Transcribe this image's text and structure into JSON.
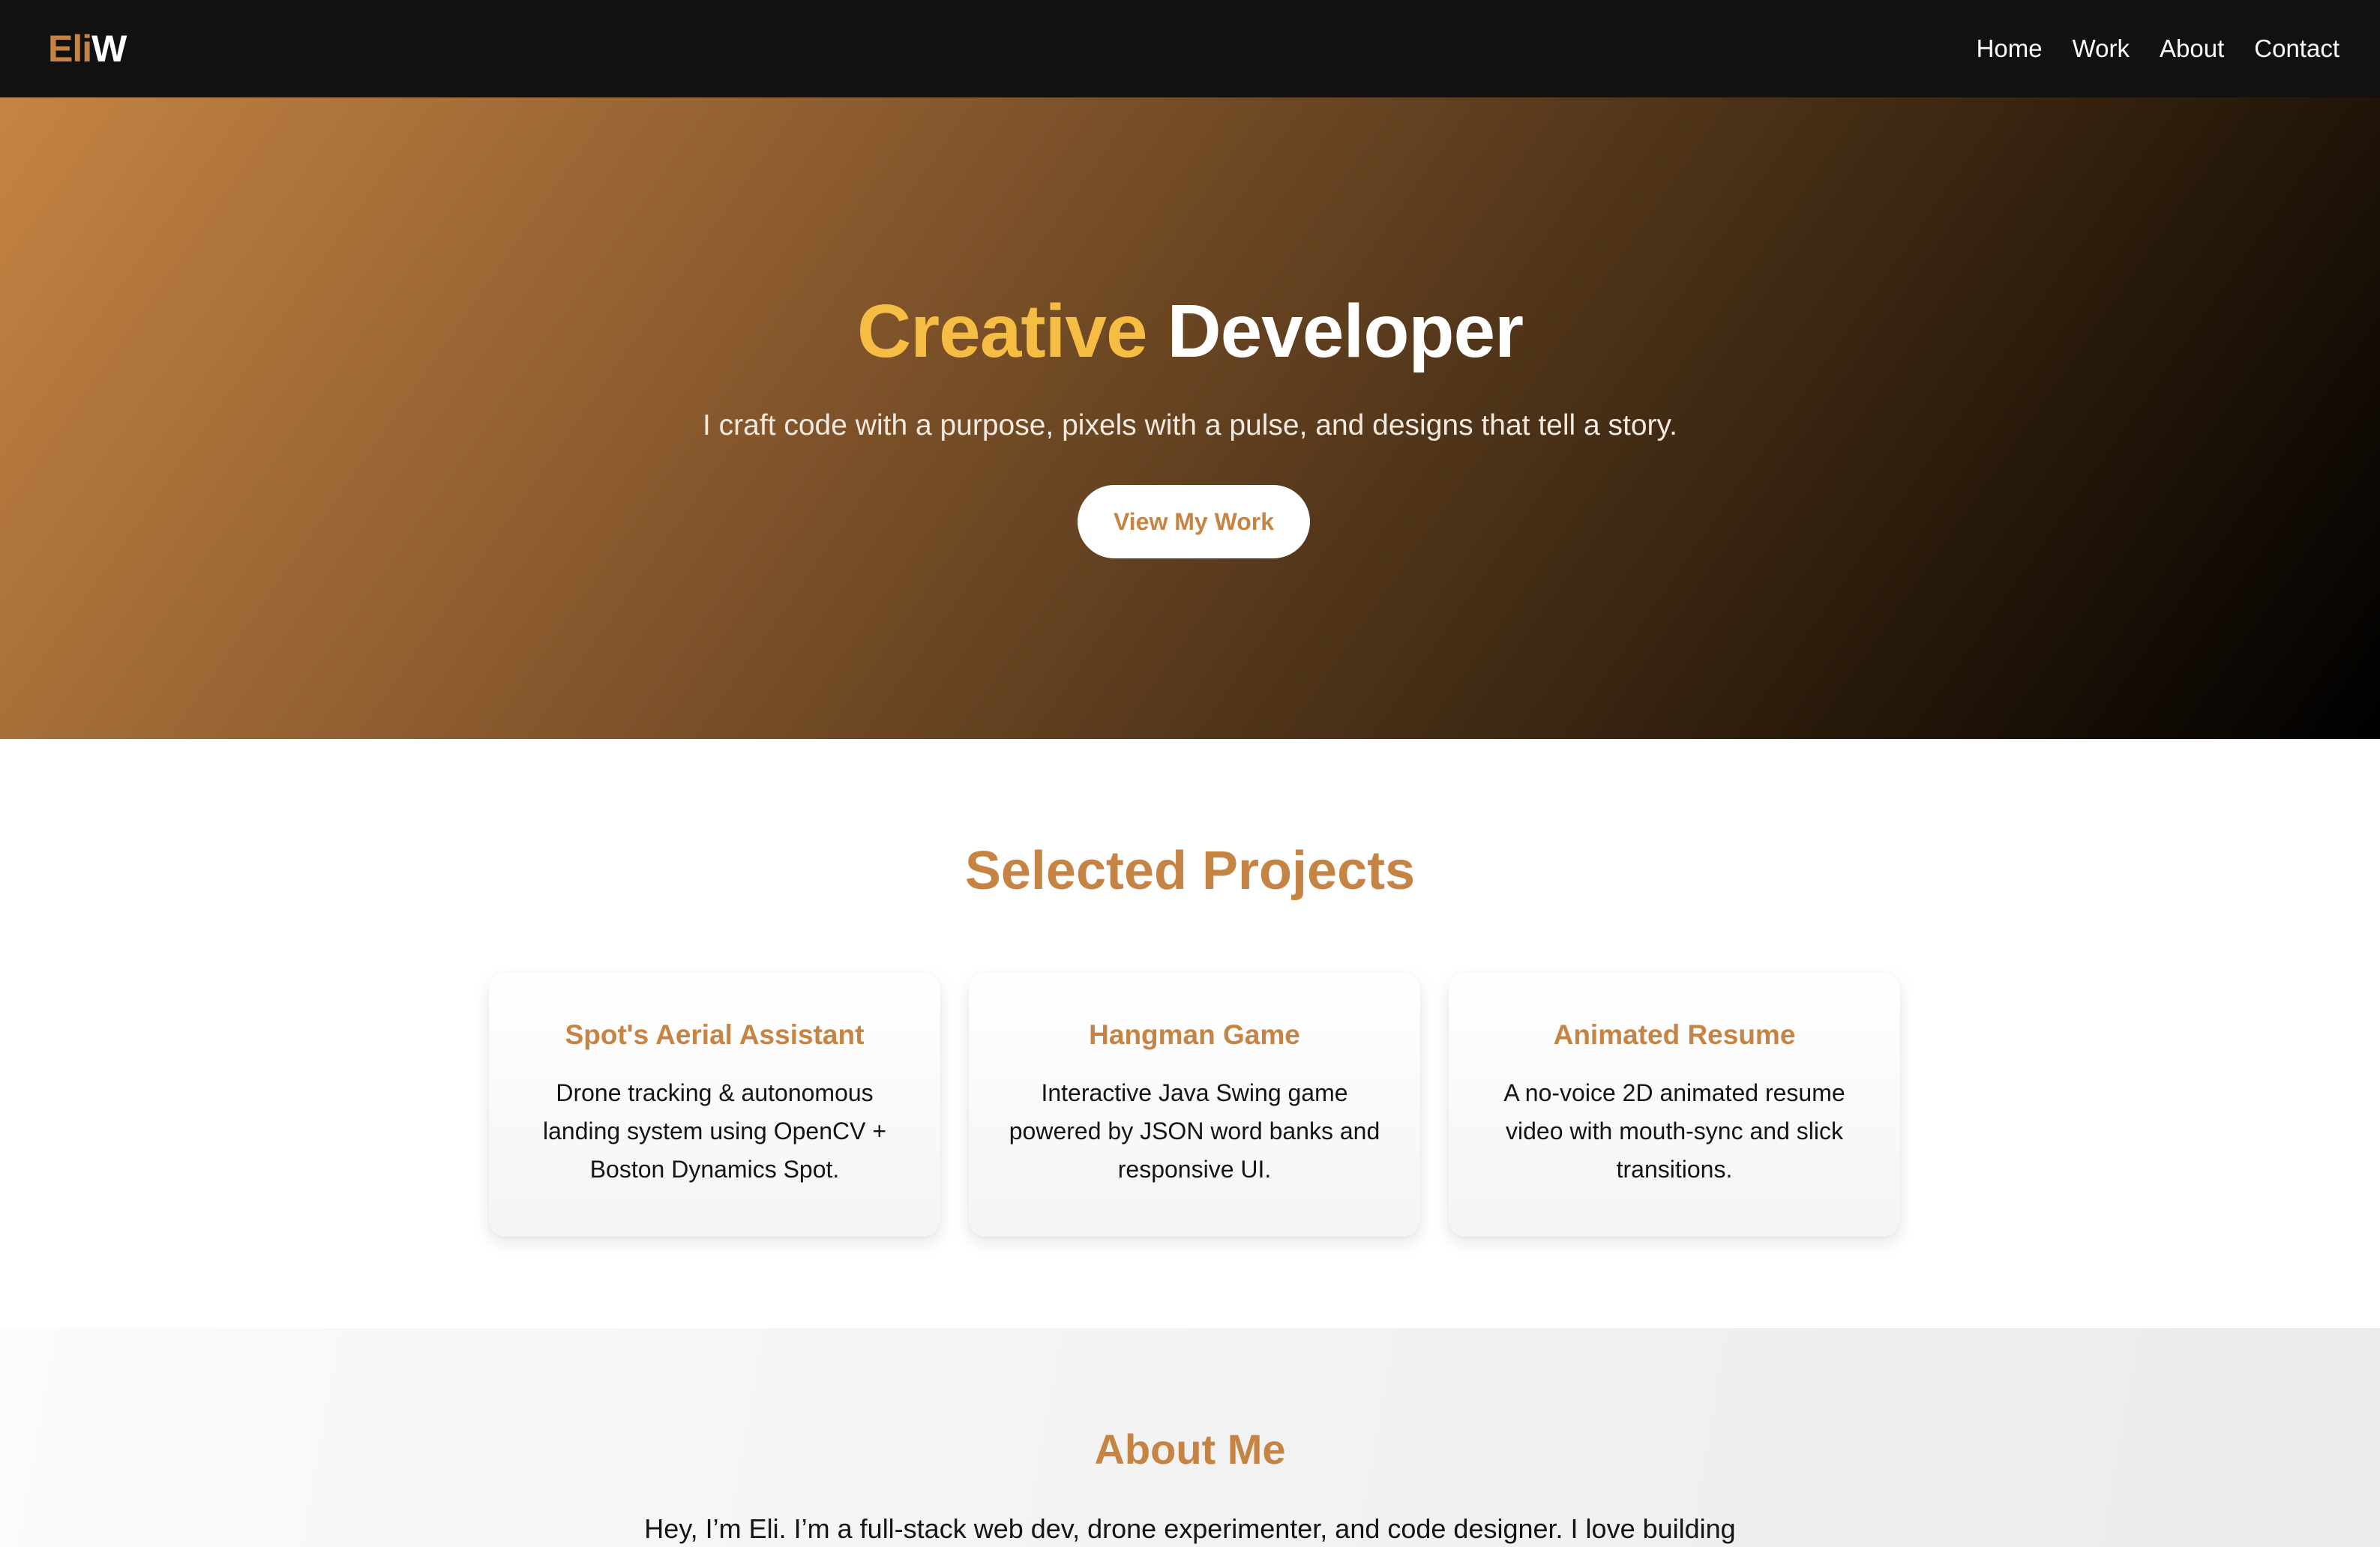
{
  "navbar": {
    "logo_part_a": "Eli",
    "logo_part_b": "W",
    "links": [
      {
        "label": "Home"
      },
      {
        "label": "Work"
      },
      {
        "label": "About"
      },
      {
        "label": "Contact"
      }
    ]
  },
  "hero": {
    "title_accent": "Creative",
    "title_main": "Developer",
    "subtitle": "I craft code with a purpose, pixels with a pulse, and designs that tell a story.",
    "cta_label": "View My Work"
  },
  "projects": {
    "title": "Selected Projects",
    "cards": [
      {
        "title": "Spot's Aerial Assistant",
        "description": "Drone tracking & autonomous landing system using OpenCV + Boston Dynamics Spot."
      },
      {
        "title": "Hangman Game",
        "description": "Interactive Java Swing game powered by JSON word banks and responsive UI."
      },
      {
        "title": "Animated Resume",
        "description": "A no-voice 2D animated resume video with mouth-sync and slick transitions."
      }
    ]
  },
  "about": {
    "title": "About Me",
    "text": "Hey, I’m Eli. I’m a full-stack web dev, drone experimenter, and code designer. I love building"
  },
  "colors": {
    "brand": "#c58443",
    "accent_yellow": "#f5bd43",
    "nav_bg": "#111111"
  }
}
